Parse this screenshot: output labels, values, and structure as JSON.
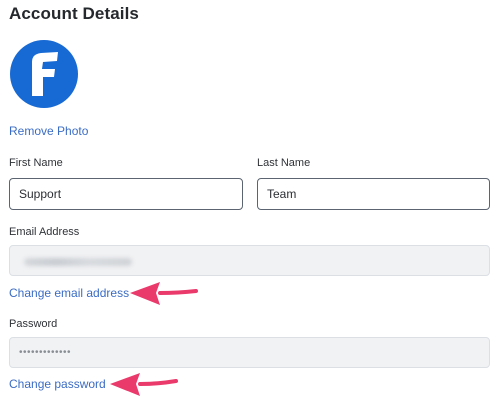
{
  "header": {
    "title": "Account Details"
  },
  "profile": {
    "avatar_letter": "F",
    "avatar_color": "#1769d3",
    "remove_photo_label": "Remove Photo"
  },
  "form": {
    "first_name": {
      "label": "First Name",
      "value": "Support"
    },
    "last_name": {
      "label": "Last Name",
      "value": "Team"
    },
    "email": {
      "label": "Email Address",
      "value": "",
      "change_label": "Change email address"
    },
    "password": {
      "label": "Password",
      "value": "•••••••••••••",
      "change_label": "Change password"
    }
  },
  "annotations": {
    "arrow_color": "#ea3a6b",
    "arrow_icon": "left-pointing-arrow"
  },
  "colors": {
    "link": "#3b6cc4",
    "input_border": "#5b6470",
    "readonly_bg": "#f1f2f4"
  }
}
